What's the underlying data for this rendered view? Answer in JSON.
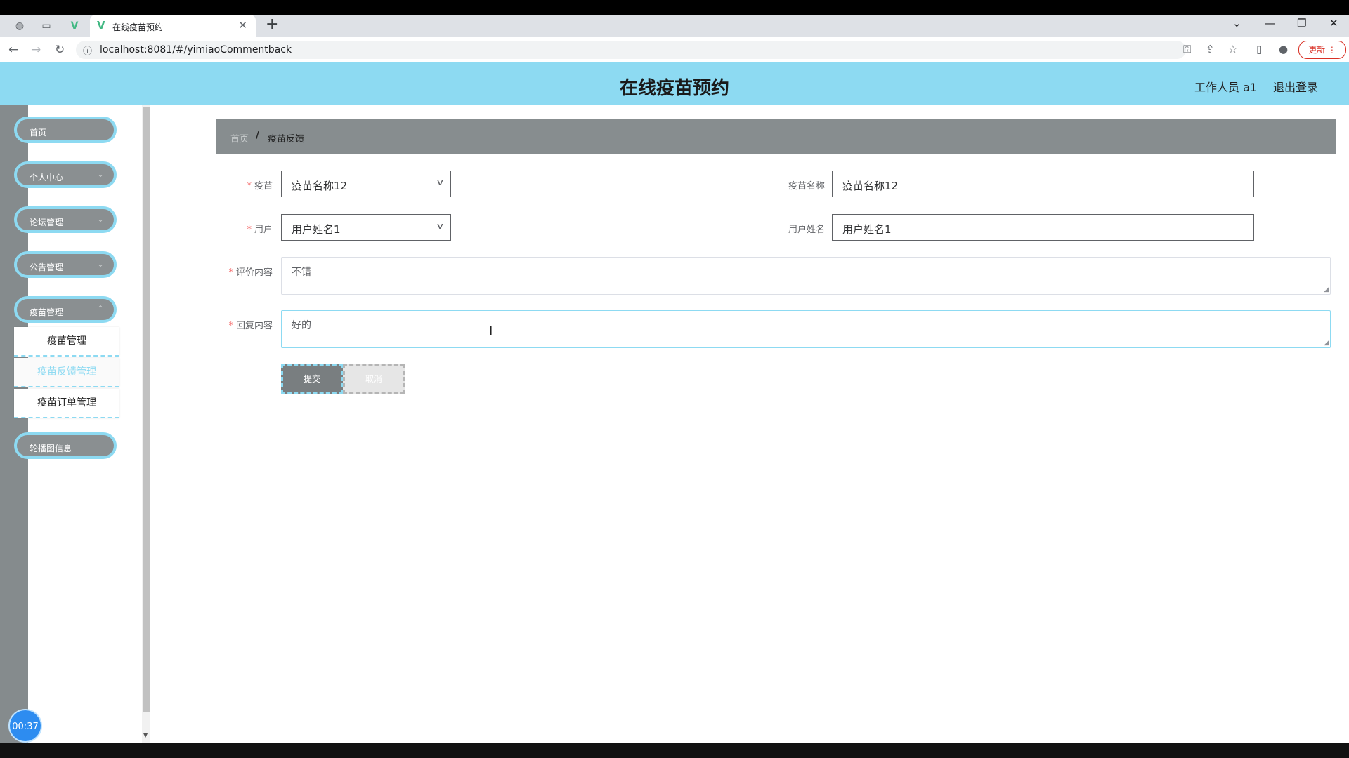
{
  "browser": {
    "tab_title": "在线疫苗预约",
    "url": "localhost:8081/#/yimiaoCommentback",
    "update_label": "更新"
  },
  "header": {
    "app_title": "在线疫苗预约",
    "user_role": "工作人员 a1",
    "logout_label": "退出登录"
  },
  "sidebar": {
    "items": [
      {
        "label": "首页"
      },
      {
        "label": "个人中心"
      },
      {
        "label": "论坛管理"
      },
      {
        "label": "公告管理"
      },
      {
        "label": "疫苗管理"
      },
      {
        "label": "轮播图信息"
      }
    ],
    "submenu": [
      {
        "label": "疫苗管理"
      },
      {
        "label": "疫苗反馈管理"
      },
      {
        "label": "疫苗订单管理"
      }
    ],
    "timer": "00:37"
  },
  "breadcrumb": {
    "home": "首页",
    "separator": "/",
    "current": "疫苗反馈"
  },
  "form": {
    "vaccine_label": "疫苗",
    "vaccine_value": "疫苗名称12",
    "vaccine_name_label": "疫苗名称",
    "vaccine_name_value": "疫苗名称12",
    "user_label": "用户",
    "user_value": "用户姓名1",
    "user_name_label": "用户姓名",
    "user_name_value": "用户姓名1",
    "comment_label": "评价内容",
    "comment_value": "不错",
    "reply_label": "回复内容",
    "reply_value": "好的",
    "submit_label": "提交",
    "cancel_label": "取消"
  }
}
